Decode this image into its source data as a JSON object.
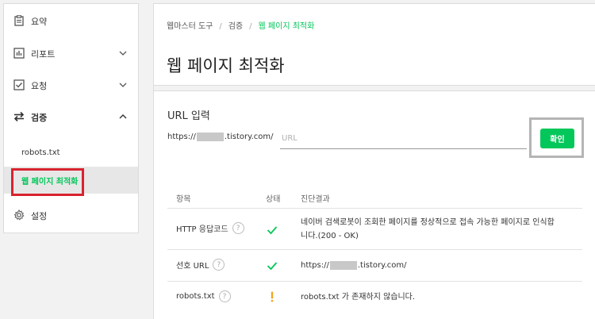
{
  "sidebar": {
    "items": [
      {
        "label": "요약",
        "icon": "clipboard-icon"
      },
      {
        "label": "리포트",
        "icon": "bar-chart-icon"
      },
      {
        "label": "요청",
        "icon": "checkbox-icon"
      },
      {
        "label": "검증",
        "icon": "swap-icon"
      },
      {
        "label": "설정",
        "icon": "gear-icon"
      }
    ],
    "sub_items": [
      "robots.txt",
      "웹 페이지 최적화"
    ]
  },
  "breadcrumb": [
    "웹마스터 도구",
    "검증",
    "웹 페이지 최적화"
  ],
  "page_title": "웹 페이지 최적화",
  "url_section": {
    "label": "URL 입력",
    "prefix_start": "https://",
    "prefix_end": ".tistory.com/",
    "placeholder": "URL",
    "confirm_label": "확인"
  },
  "table": {
    "headers": [
      "항목",
      "상태",
      "진단결과"
    ],
    "rows": [
      {
        "item": "HTTP 응답코드",
        "status": "ok",
        "result_line1": "네이버 검색로봇이 조회한 페이지를 정상적으로 접속 가능한 페이지로 인식합",
        "result_line2": "니다.(200 - OK)"
      },
      {
        "item": "선호 URL",
        "status": "ok",
        "result_start": "https://",
        "result_end": ".tistory.com/"
      },
      {
        "item": "robots.txt",
        "status": "warning",
        "result": "robots.txt 가 존재하지 않습니다."
      }
    ]
  },
  "colors": {
    "accent": "#03c75a",
    "warning": "#f5a623",
    "highlight": "#d9232f"
  }
}
